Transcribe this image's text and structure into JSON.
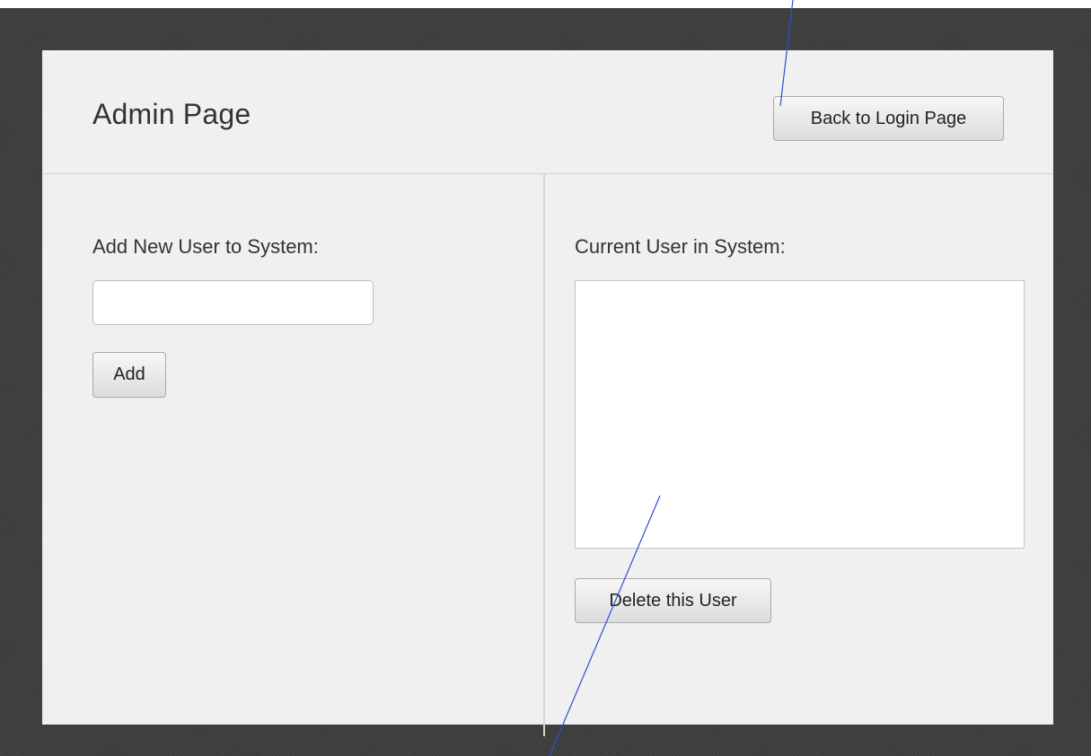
{
  "window": {
    "title": "Admin Page",
    "back_button_label": "Back to Login Page"
  },
  "add_user": {
    "label": "Add New User to System:",
    "input_value": "",
    "add_button_label": "Add"
  },
  "current_users": {
    "label": "Current User in System:",
    "users": [],
    "delete_button_label": "Delete this User"
  },
  "colors": {
    "background": "#3f3f3f",
    "panel": "#f0f0f0",
    "annotation_line": "#2f4fd0"
  }
}
